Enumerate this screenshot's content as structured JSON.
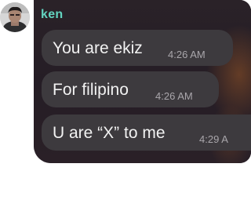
{
  "chat": {
    "sender_name": "ken",
    "messages": [
      {
        "text": "You are ekiz",
        "time": "4:26 AM"
      },
      {
        "text": "For filipino",
        "time": "4:26 AM"
      },
      {
        "text": "U are “X” to me",
        "time": "4:29 A"
      }
    ]
  },
  "colors": {
    "sender": "#63d4c0",
    "bubble": "#3d3a3e",
    "card": "#221b23",
    "message_text": "#f2f2f2",
    "timestamp": "#a9a6ab"
  },
  "icons": {
    "avatar": "user-avatar-photo"
  }
}
